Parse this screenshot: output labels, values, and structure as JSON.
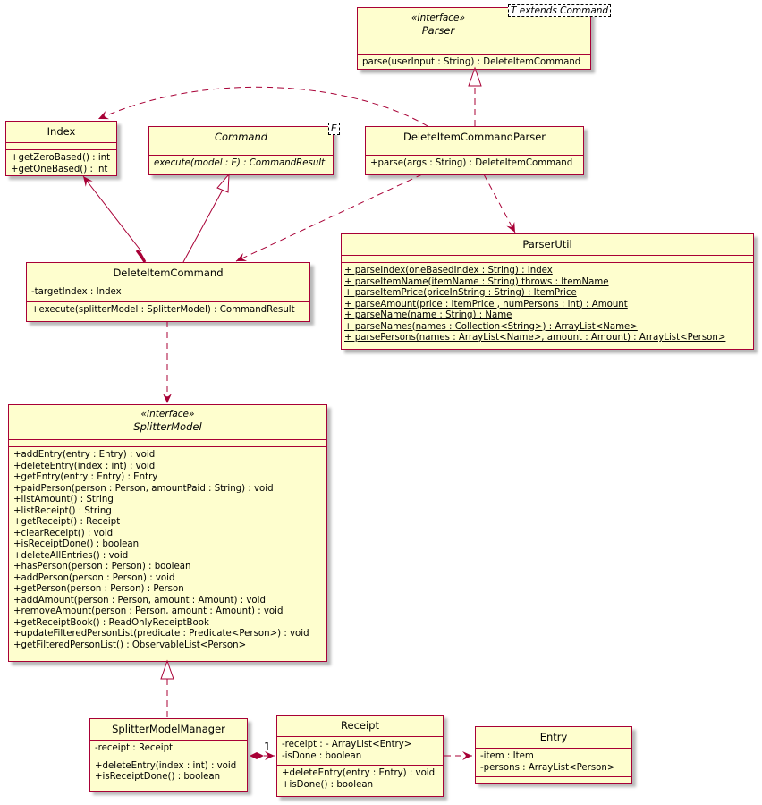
{
  "diagram": {
    "type": "uml-class-diagram",
    "colors": {
      "border": "#A80036",
      "fill": "#FEFECE",
      "edge": "#A80036"
    },
    "classes": {
      "parser": {
        "stereotype": "«Interface»",
        "name": "Parser",
        "template": "T extends Command",
        "attributes": [],
        "methods": [
          "parse(userInput : String) : DeleteItemCommand"
        ]
      },
      "index": {
        "name": "Index",
        "attributes": [],
        "methods": [
          "+getZeroBased() : int",
          "+getOneBased() : int"
        ]
      },
      "command": {
        "name": "Command",
        "template": "E",
        "attributes": [],
        "methods": [
          "execute(model : E) : CommandResult"
        ]
      },
      "deleteItemCommandParser": {
        "name": "DeleteItemCommandParser",
        "attributes": [],
        "methods": [
          "+parse(args : String) : DeleteItemCommand"
        ]
      },
      "deleteItemCommand": {
        "name": "DeleteItemCommand",
        "attributes": [
          "-targetIndex : Index"
        ],
        "methods": [
          "+execute(splitterModel : SplitterModel) : CommandResult"
        ]
      },
      "parserUtil": {
        "name": "ParserUtil",
        "attributes": [],
        "methods": [
          " + parseIndex(oneBasedIndex : String) : Index",
          " + parseItemName(itemName : String) throws : ItemName",
          " + parseItemPrice(priceInString : String) : ItemPrice",
          " + parseAmount(price : ItemPrice , numPersons : int) : Amount",
          " + parseName(name : String) : Name",
          " + parseNames(names : Collection<String>) : ArrayList<Name>",
          " + parsePersons(names : ArrayList<Name>, amount : Amount) : ArrayList<Person>"
        ]
      },
      "splitterModel": {
        "stereotype": "«Interface»",
        "name": "SplitterModel",
        "attributes": [],
        "methods": [
          "+addEntry(entry : Entry) : void",
          "+deleteEntry(index : int) : void",
          "+getEntry(entry : Entry) : Entry",
          "+paidPerson(person : Person, amountPaid : String) : void",
          "+listAmount() : String",
          "+listReceipt() : String",
          "+getReceipt() : Receipt",
          "+clearReceipt() : void",
          "+isReceiptDone() : boolean",
          "+deleteAllEntries() : void",
          "+hasPerson(person : Person) : boolean",
          "+addPerson(person : Person) : void",
          "+getPerson(person : Person) : Person",
          "+addAmount(person : Person, amount : Amount) : void",
          "+removeAmount(person : Person, amount : Amount) : void",
          "+getReceiptBook() : ReadOnlyReceiptBook",
          "+updateFilteredPersonList(predicate : Predicate<Person>) : void",
          "+getFilteredPersonList() : ObservableList<Person>"
        ]
      },
      "splitterModelManager": {
        "name": "SplitterModelManager",
        "attributes": [
          "-receipt : Receipt"
        ],
        "methods": [
          "+deleteEntry(index : int) : void",
          "+isReceiptDone() : boolean"
        ]
      },
      "receipt": {
        "name": "Receipt",
        "attributes": [
          "-receipt : - ArrayList<Entry>",
          "-isDone : boolean"
        ],
        "methods": [
          "+deleteEntry(entry : Entry) : void",
          "+isDone() : boolean"
        ]
      },
      "entry": {
        "name": "Entry",
        "attributes": [
          "-item : Item",
          "-persons : ArrayList<Person>"
        ],
        "methods": []
      }
    },
    "relations": [
      {
        "from": "DeleteItemCommandParser",
        "to": "Parser",
        "kind": "realization"
      },
      {
        "from": "DeleteItemCommandParser",
        "to": "Index",
        "kind": "dependency"
      },
      {
        "from": "DeleteItemCommandParser",
        "to": "DeleteItemCommand",
        "kind": "dependency"
      },
      {
        "from": "DeleteItemCommandParser",
        "to": "ParserUtil",
        "kind": "dependency"
      },
      {
        "from": "DeleteItemCommand",
        "to": "Command",
        "kind": "generalization"
      },
      {
        "from": "DeleteItemCommand",
        "to": "Index",
        "kind": "composition"
      },
      {
        "from": "DeleteItemCommand",
        "to": "SplitterModel",
        "kind": "dependency"
      },
      {
        "from": "SplitterModelManager",
        "to": "SplitterModel",
        "kind": "realization"
      },
      {
        "from": "SplitterModelManager",
        "to": "Receipt",
        "kind": "composition",
        "multiplicity": "1"
      },
      {
        "from": "Receipt",
        "to": "Entry",
        "kind": "dependency"
      }
    ]
  }
}
